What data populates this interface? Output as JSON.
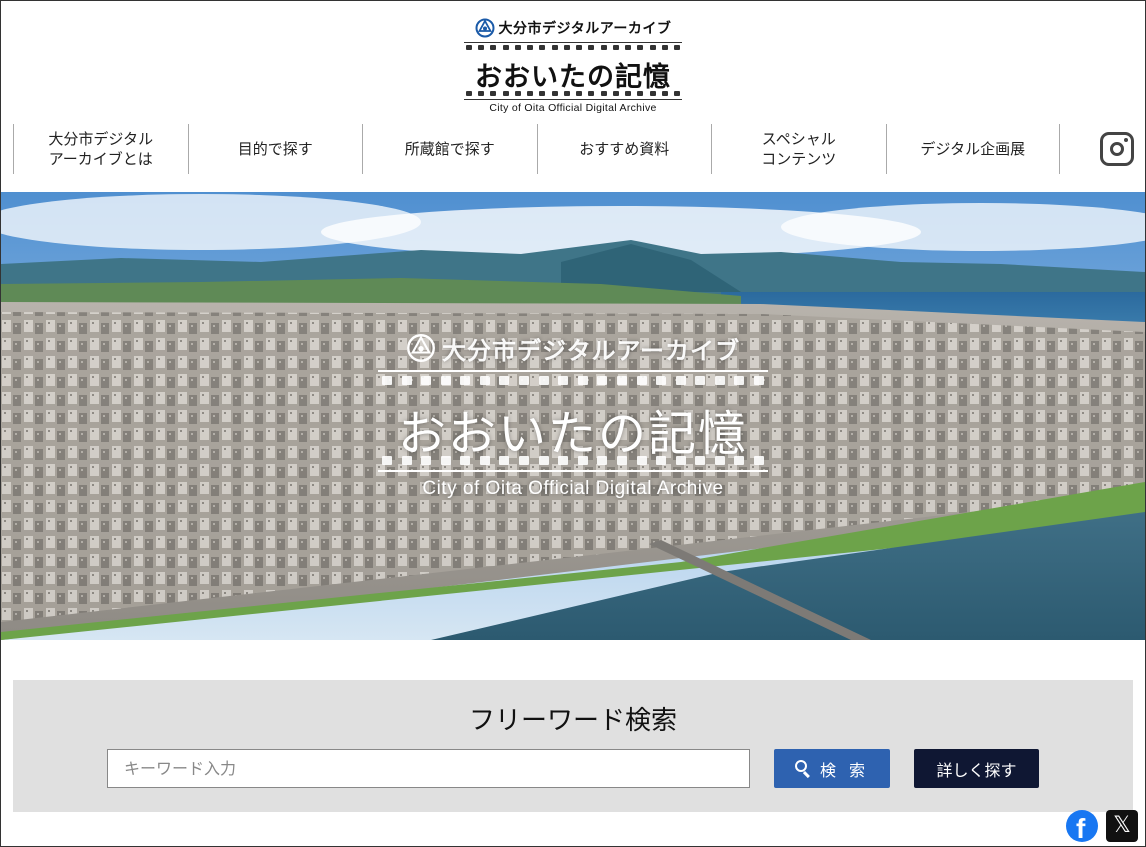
{
  "header": {
    "site_name": "大分市デジタルアーカイブ",
    "title": "おおいたの記憶",
    "subtitle_en": "City of Oita Official Digital Archive"
  },
  "nav": {
    "items": [
      {
        "label": "大分市デジタル\nアーカイブとは"
      },
      {
        "label": "目的で探す"
      },
      {
        "label": "所蔵館で探す"
      },
      {
        "label": "おすすめ資料"
      },
      {
        "label": "スペシャル\nコンテンツ"
      },
      {
        "label": "デジタル企画展"
      }
    ],
    "instagram_icon": "instagram-icon"
  },
  "hero": {
    "site_name": "大分市デジタルアーカイブ",
    "title": "おおいたの記憶",
    "subtitle_en": "City of Oita Official Digital Archive"
  },
  "search": {
    "title": "フリーワード検索",
    "placeholder": "キーワード入力",
    "value": "",
    "search_button": "検 索",
    "detail_button": "詳しく探す"
  },
  "share": {
    "facebook_icon": "facebook-icon",
    "x_icon": "x-icon"
  },
  "colors": {
    "search_button": "#2e62b0",
    "detail_button": "#0f1733",
    "facebook": "#1877f2"
  }
}
